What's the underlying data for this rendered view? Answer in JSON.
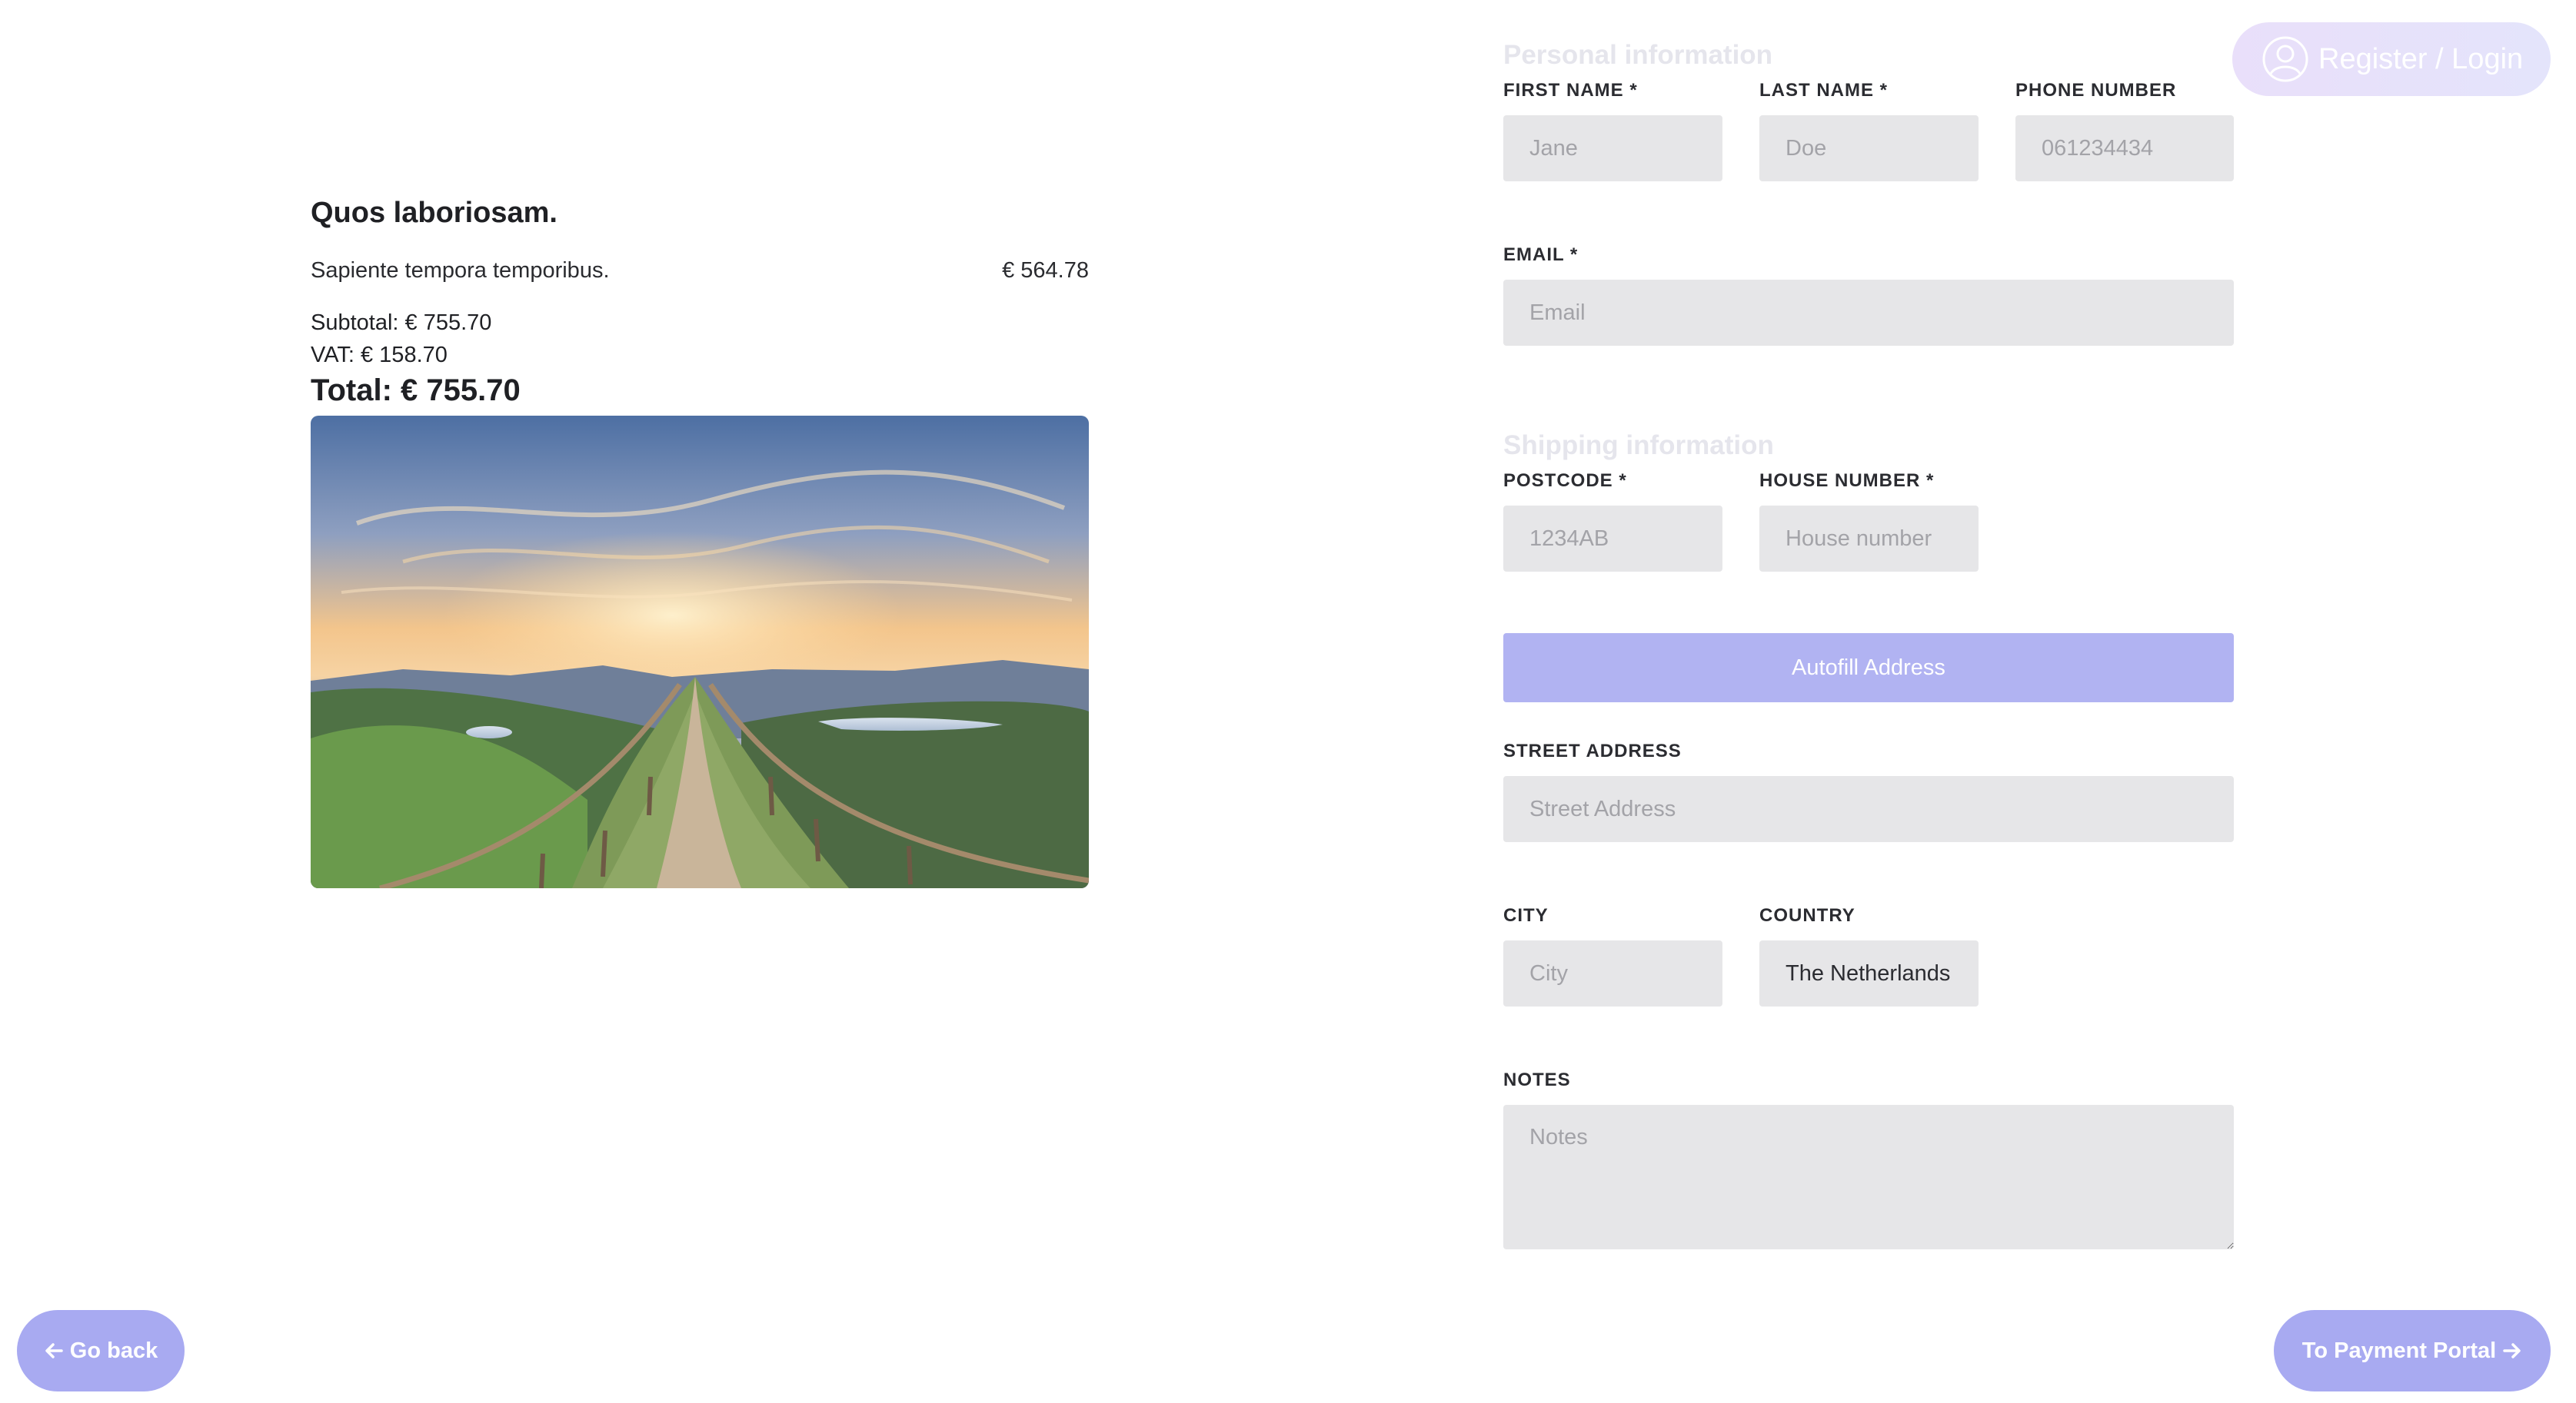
{
  "header": {
    "login_label": "Register / Login",
    "login_icon": "user-circle-icon"
  },
  "order": {
    "product_title": "Quos laboriosam.",
    "item_name": "Sapiente tempora temporibus.",
    "item_price": "€ 564.78",
    "subtotal": "Subtotal: € 755.70",
    "vat": "VAT: € 158.70",
    "total": "Total: € 755.70",
    "image_description": "mountain-path-sunrise-photo"
  },
  "personal": {
    "heading": "Personal information",
    "first_name_label": "FIRST NAME *",
    "first_name_placeholder": "Jane",
    "last_name_label": "LAST NAME *",
    "last_name_placeholder": "Doe",
    "phone_label": "PHONE NUMBER",
    "phone_placeholder": "061234434",
    "email_label": "EMAIL *",
    "email_placeholder": "Email"
  },
  "shipping": {
    "heading": "Shipping information",
    "postcode_label": "POSTCODE *",
    "postcode_placeholder": "1234AB",
    "house_number_label": "HOUSE NUMBER *",
    "house_number_placeholder": "House number",
    "autofill_label": "Autofill Address",
    "street_label": "STREET ADDRESS",
    "street_placeholder": "Street Address",
    "city_label": "CITY",
    "city_placeholder": "City",
    "country_label": "COUNTRY",
    "country_value": "The Netherlands",
    "notes_label": "NOTES",
    "notes_placeholder": "Notes"
  },
  "nav": {
    "back_label": "Go back",
    "back_icon": "arrow-left-icon",
    "next_label": "To Payment Portal",
    "next_icon": "arrow-right-icon"
  },
  "colors": {
    "accent": "#a8aaf1",
    "autofill_button": "#b1b3f2",
    "input_background": "#e6e6e8",
    "muted_heading": "#e5e5ec"
  }
}
